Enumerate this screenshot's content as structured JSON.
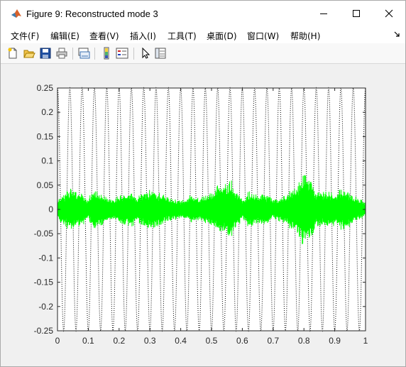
{
  "window": {
    "title": "Figure 9: Reconstructed mode 3"
  },
  "titlebar_controls": [
    "minimize-icon",
    "maximize-icon",
    "close-icon"
  ],
  "menu": {
    "items": [
      "文件(F)",
      "编辑(E)",
      "查看(V)",
      "插入(I)",
      "工具(T)",
      "桌面(D)",
      "窗口(W)",
      "帮助(H)"
    ]
  },
  "toolbar": {
    "buttons": [
      "new-figure-icon",
      "open-file-icon",
      "save-icon",
      "print-icon",
      "link-plot-icon",
      "colorbar-icon",
      "legend-icon",
      "pointer-icon",
      "property-editor-icon"
    ]
  },
  "colors": {
    "signal": "#00ff00",
    "reference": "#000000",
    "axes_background": "#ffffff",
    "figure_background": "#f0f0f0"
  },
  "chart_data": {
    "type": "line",
    "title": "",
    "xlabel": "",
    "ylabel": "",
    "xlim": [
      0,
      1
    ],
    "ylim": [
      -0.25,
      0.25
    ],
    "x_ticks": [
      "0",
      "0.1",
      "0.2",
      "0.3",
      "0.4",
      "0.5",
      "0.6",
      "0.7",
      "0.8",
      "0.9",
      "1"
    ],
    "y_ticks": [
      "0.25",
      "0.2",
      "0.15",
      "0.1",
      "0.05",
      "0",
      "-0.05",
      "-0.1",
      "-0.15",
      "-0.2",
      "-0.25"
    ],
    "series": [
      {
        "style": "dotted",
        "color": "#000000",
        "description": "sinusoid",
        "amplitude": 0.25,
        "cycles": 25
      },
      {
        "style": "solid",
        "color": "#00ff00",
        "description": "oscillation",
        "envelope_x": [
          0,
          0.02,
          0.05,
          0.08,
          0.1,
          0.12,
          0.15,
          0.18,
          0.2,
          0.23,
          0.26,
          0.3,
          0.33,
          0.36,
          0.4,
          0.43,
          0.46,
          0.5,
          0.52,
          0.54,
          0.56,
          0.59,
          0.6,
          0.62,
          0.65,
          0.68,
          0.7,
          0.73,
          0.75,
          0.78,
          0.8,
          0.82,
          0.84,
          0.87,
          0.9,
          0.93,
          0.96,
          1.0
        ],
        "envelope_y": [
          0.02,
          0.035,
          0.05,
          0.035,
          0.025,
          0.045,
          0.03,
          0.02,
          0.03,
          0.04,
          0.03,
          0.045,
          0.035,
          0.025,
          0.02,
          0.03,
          0.025,
          0.035,
          0.05,
          0.055,
          0.065,
          0.035,
          0.02,
          0.04,
          0.03,
          0.035,
          0.02,
          0.03,
          0.04,
          0.055,
          0.08,
          0.065,
          0.035,
          0.04,
          0.035,
          0.05,
          0.03,
          0.015
        ]
      }
    ]
  }
}
